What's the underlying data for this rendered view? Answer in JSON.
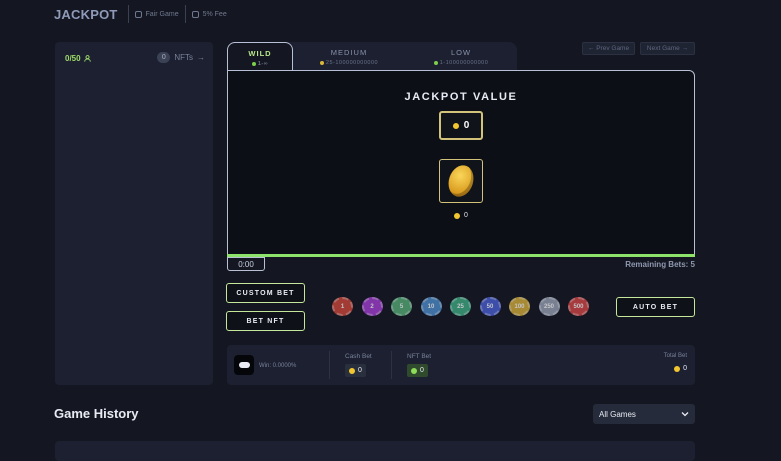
{
  "header": {
    "title": "JACKPOT",
    "badges": [
      {
        "label": "Fair Game",
        "icon": "shield-icon"
      },
      {
        "label": "5% Fee",
        "icon": "shield-icon"
      }
    ]
  },
  "sidebar": {
    "player_count": "0/50",
    "nft_count": "0",
    "nft_label": "NFTs",
    "user_icon": "user-icon",
    "arrow_icon": "arrow-right-icon"
  },
  "tabs": [
    {
      "label": "WILD",
      "range": "1-∞",
      "active": true
    },
    {
      "label": "MEDIUM",
      "range": "25-100000000000",
      "active": false
    },
    {
      "label": "LOW",
      "range": "1-100000000000",
      "active": false
    }
  ],
  "nav": {
    "prev": "Prev Game",
    "next": "Next Game"
  },
  "jackpot": {
    "title": "JACKPOT VALUE",
    "value": "0",
    "coin_value": "0"
  },
  "timer": "0:00",
  "remaining": {
    "label": "Remaining Bets:",
    "value": "5"
  },
  "buttons": {
    "custom_bet": "CUSTOM BET",
    "bet_nft": "BET NFT",
    "auto_bet": "AUTO BET"
  },
  "chips": [
    {
      "value": "1",
      "color": "#d1483b"
    },
    {
      "value": "2",
      "color": "#a63fd6"
    },
    {
      "value": "5",
      "color": "#57b07a"
    },
    {
      "value": "10",
      "color": "#4f8fd0"
    },
    {
      "value": "25",
      "color": "#3fae86"
    },
    {
      "value": "50",
      "color": "#4a5fd8"
    },
    {
      "value": "100",
      "color": "#d9b13a"
    },
    {
      "value": "250",
      "color": "#9aa4b8"
    },
    {
      "value": "500",
      "color": "#d84646"
    }
  ],
  "summary": {
    "win": "Win: 0.0000%",
    "cash_bet_label": "Cash Bet",
    "cash_bet_value": "0",
    "nft_bet_label": "NFT Bet",
    "nft_bet_value": "0",
    "total_bet_label": "Total Bet",
    "total_bet_value": "0"
  },
  "history": {
    "title": "Game History",
    "filter": "All Games"
  },
  "colors": {
    "accent_green": "#9fdc6a",
    "gold": "#f2c630",
    "bg": "#141721",
    "panel": "#1c2030"
  }
}
